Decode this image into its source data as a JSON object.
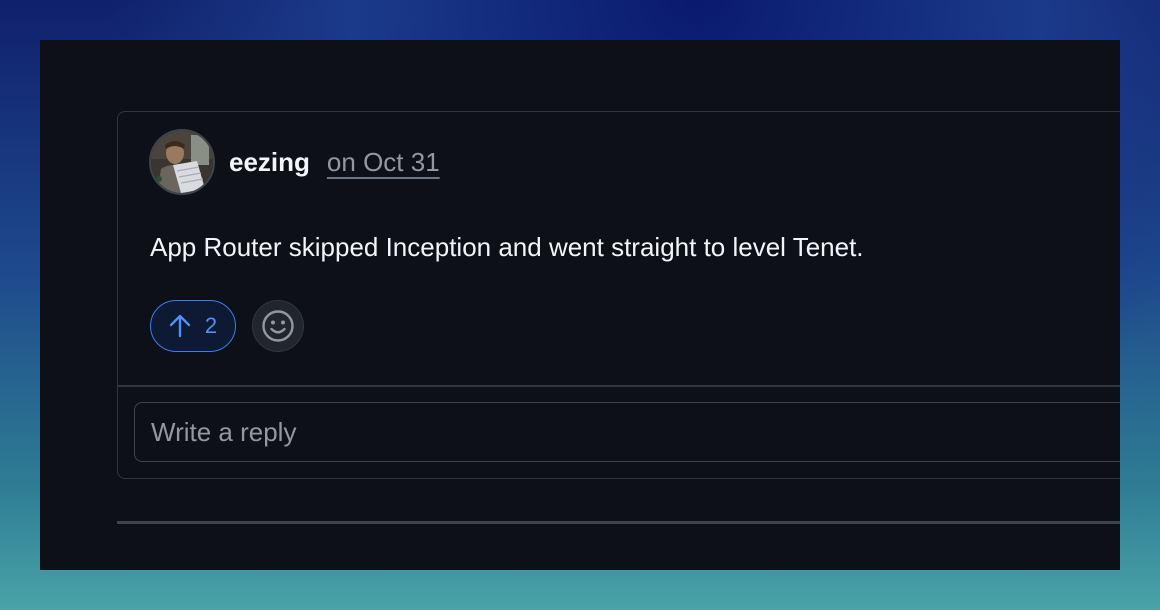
{
  "comment": {
    "author": "eezing",
    "timestamp": "on Oct 31",
    "body": "App Router skipped Inception and went straight to level Tenet."
  },
  "reactions": {
    "upvote_icon": "arrow-up-icon",
    "upvote_count": "2",
    "emoji_icon": "smiley-icon"
  },
  "reply": {
    "placeholder": "Write a reply"
  },
  "colors": {
    "background": "#0d1117",
    "accent": "#4f8ff7",
    "border": "#30363d",
    "muted_text": "#9198a1"
  }
}
